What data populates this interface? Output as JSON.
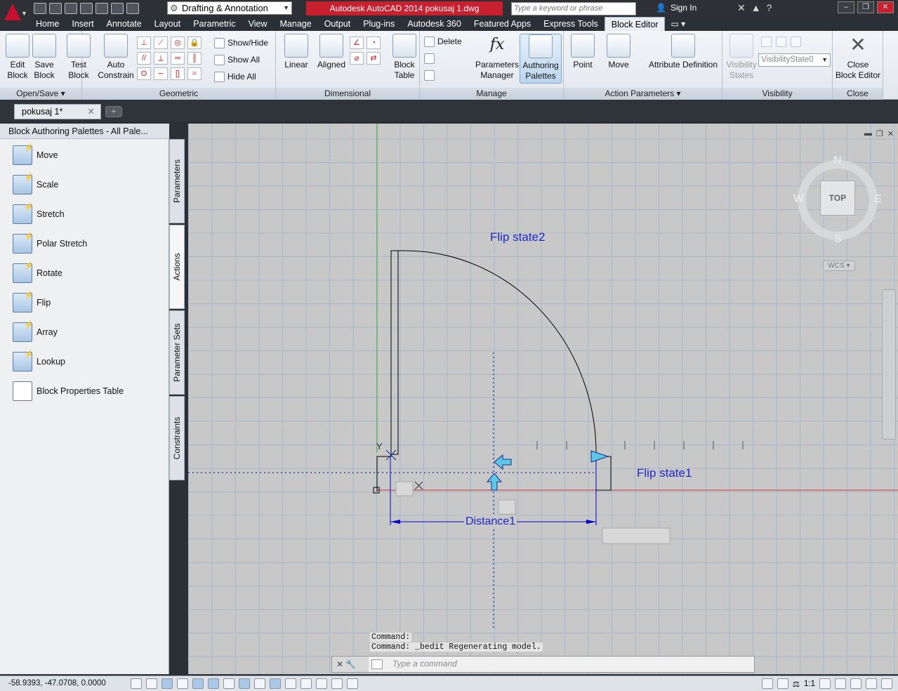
{
  "title": {
    "workspace": "Drafting & Annotation",
    "app_title": "Autodesk AutoCAD 2014    pokusaj 1.dwg",
    "search_placeholder": "Type a keyword or phrase",
    "sign_in": "Sign In"
  },
  "menu": [
    "Home",
    "Insert",
    "Annotate",
    "Layout",
    "Parametric",
    "View",
    "Manage",
    "Output",
    "Plug-ins",
    "Autodesk 360",
    "Featured Apps",
    "Express Tools",
    "Block Editor"
  ],
  "ribbon": {
    "open_save": {
      "title": "Open/Save",
      "edit_block": "Edit\nBlock",
      "save_block": "Save\nBlock"
    },
    "geometric": {
      "title": "Geometric",
      "test_block": "Test\nBlock",
      "auto_constrain": "Auto\nConstrain",
      "show_hide": "Show/Hide",
      "show_all": "Show All",
      "hide_all": "Hide All"
    },
    "dimensional": {
      "title": "Dimensional",
      "linear": "Linear",
      "aligned": "Aligned",
      "block_table": "Block\nTable"
    },
    "manage": {
      "title": "Manage",
      "delete": "Delete",
      "parameters_manager": "Parameters\nManager",
      "authoring_palettes": "Authoring\nPalettes"
    },
    "action_parameters": {
      "title": "Action Parameters",
      "point": "Point",
      "move": "Move",
      "attribute_definition": "Attribute Definition"
    },
    "visibility": {
      "title": "Visibility",
      "visibility_states": "Visibility\nStates",
      "state": "VisibilityState0"
    },
    "close": {
      "title": "Close",
      "close_block_editor": "Close\nBlock Editor"
    }
  },
  "doc_tab": "pokusaj 1*",
  "palette": {
    "title": "Block Authoring Palettes - All Pale...",
    "items": [
      "Move",
      "Scale",
      "Stretch",
      "Polar Stretch",
      "Rotate",
      "Flip",
      "Array",
      "Lookup",
      "Block Properties Table"
    ],
    "tabs": [
      "Parameters",
      "Actions",
      "Parameter Sets",
      "Constraints"
    ]
  },
  "drawing": {
    "flip_state2": "Flip  state2",
    "flip_state1": "Flip  state1",
    "distance": "Distance1",
    "ucs_y": "Y"
  },
  "viewcube": {
    "n": "N",
    "s": "S",
    "e": "E",
    "w": "W",
    "top": "TOP",
    "wcs": "WCS"
  },
  "command": {
    "history": [
      "Command:",
      "Command: _bedit Regenerating model."
    ],
    "placeholder": "Type a command"
  },
  "status": {
    "coords": "-58.9393, -47.0708, 0.0000",
    "scale": "1:1"
  }
}
